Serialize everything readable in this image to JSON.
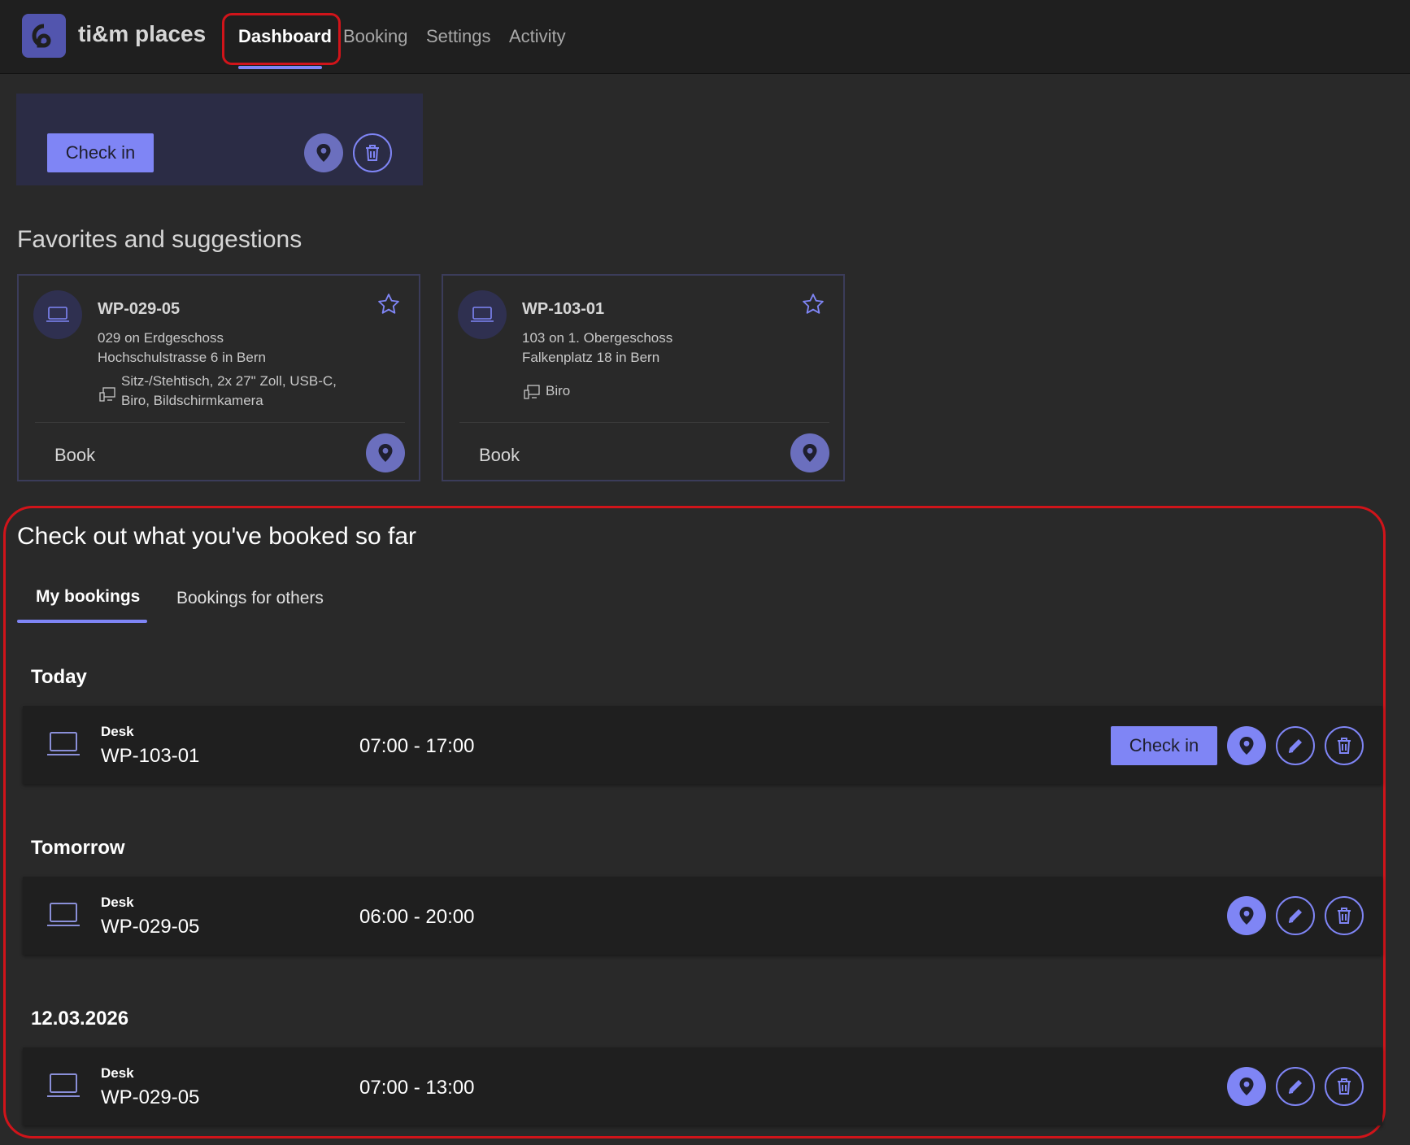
{
  "app": {
    "name": "ti&m places"
  },
  "nav": {
    "tabs": [
      {
        "label": "Dashboard",
        "active": true
      },
      {
        "label": "Booking"
      },
      {
        "label": "Settings"
      },
      {
        "label": "Activity"
      }
    ]
  },
  "checkin_panel": {
    "button_label": "Check in"
  },
  "favorites": {
    "title": "Favorites and suggestions",
    "cards": [
      {
        "title": "WP-029-05",
        "room": "029 on Erdgeschoss",
        "address": "Hochschulstrasse 6 in Bern",
        "equipment_line1": "Sitz-/Stehtisch, 2x 27\" Zoll, USB-C,",
        "equipment_line2": "Biro, Bildschirmkamera",
        "book_label": "Book"
      },
      {
        "title": "WP-103-01",
        "room": "103 on 1. Obergeschoss",
        "address": "Falkenplatz 18 in Bern",
        "equipment_line1": "Biro",
        "book_label": "Book"
      }
    ]
  },
  "bookings": {
    "title": "Check out what you've booked so far",
    "tabs": [
      {
        "label": "My bookings",
        "active": true
      },
      {
        "label": "Bookings for others"
      }
    ],
    "groups": [
      {
        "label": "Today",
        "type": "Desk",
        "name": "WP-103-01",
        "time": "07:00 - 17:00",
        "checkin_label": "Check in"
      },
      {
        "label": "Tomorrow",
        "type": "Desk",
        "name": "WP-029-05",
        "time": "06:00 - 20:00"
      },
      {
        "label": "12.03.2026",
        "type": "Desk",
        "name": "WP-029-05",
        "time": "07:00 - 13:00"
      }
    ]
  },
  "colors": {
    "accent": "#7f85f5",
    "highlight": "#d0141a",
    "background": "#292929",
    "topbar": "#1f1f1f"
  },
  "icons": [
    "logo-icon",
    "location-pin-icon",
    "trash-icon",
    "edit-pencil-icon",
    "laptop-icon",
    "monitor-equipment-icon",
    "star-outline-icon"
  ]
}
